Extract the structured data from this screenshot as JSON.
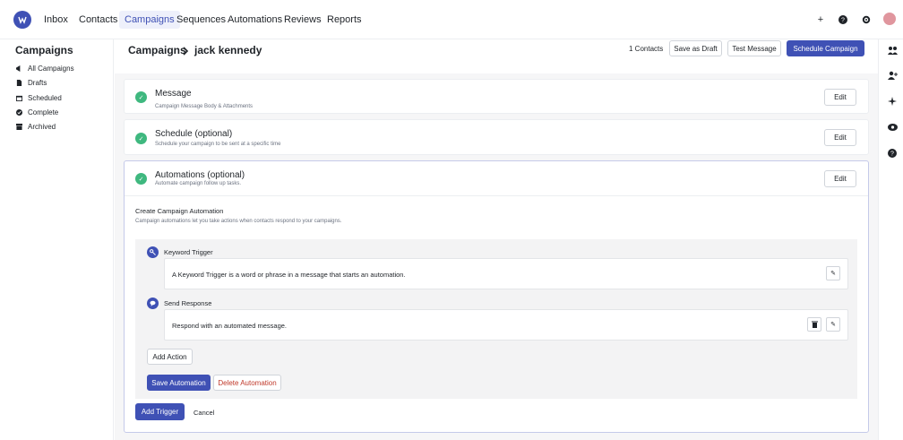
{
  "topnav": {
    "items": [
      "Inbox",
      "Contacts",
      "Campaigns",
      "Sequences",
      "Automations",
      "Reviews",
      "Reports"
    ],
    "active": "Campaigns",
    "icons": [
      "plus-icon",
      "help-icon",
      "gear-icon"
    ]
  },
  "sidebar": {
    "title": "Campaigns",
    "items": [
      {
        "label": "All Campaigns",
        "icon": "megaphone-icon"
      },
      {
        "label": "Drafts",
        "icon": "document-icon"
      },
      {
        "label": "Scheduled",
        "icon": "calendar-icon"
      },
      {
        "label": "Complete",
        "icon": "check-circle-icon"
      },
      {
        "label": "Archived",
        "icon": "archive-icon"
      }
    ]
  },
  "header": {
    "breadcrumb_root": "Campaigns",
    "breadcrumb_current": "jack kennedy",
    "contacts": "1 Contacts",
    "save_draft": "Save as Draft",
    "test_message": "Test Message",
    "schedule": "Schedule Campaign"
  },
  "steps": [
    {
      "title": "Message",
      "subtitle": "Campaign Message Body & Attachments",
      "edit": "Edit"
    },
    {
      "title": "Schedule (optional)",
      "subtitle": "Schedule your campaign to be sent at a specific time",
      "edit": "Edit"
    },
    {
      "title": "Automations (optional)",
      "subtitle": "Automate campaign follow up tasks.",
      "edit": "Edit"
    }
  ],
  "automation": {
    "heading": "Create Campaign Automation",
    "description": "Campaign automations let you take actions when contacts respond to your campaigns.",
    "trigger_label": "Keyword Trigger",
    "trigger_text": "A Keyword Trigger is a word or phrase in a message that starts an automation.",
    "action_label": "Send Response",
    "action_text": "Respond with an automated message.",
    "add_action": "Add Action",
    "save": "Save Automation",
    "delete": "Delete Automation",
    "add_trigger": "Add Trigger",
    "cancel": "Cancel"
  },
  "colors": {
    "accent": "#3f51b5",
    "success": "#3fb87f",
    "danger": "#c0392b"
  }
}
